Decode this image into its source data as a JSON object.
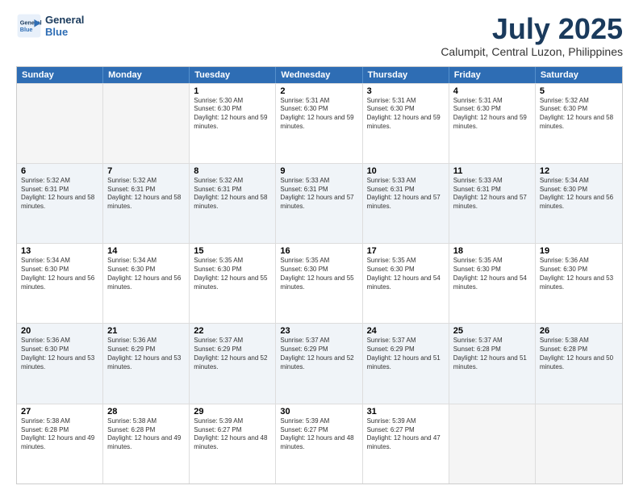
{
  "logo": {
    "line1": "General",
    "line2": "Blue"
  },
  "title": "July 2025",
  "subtitle": "Calumpit, Central Luzon, Philippines",
  "days": [
    "Sunday",
    "Monday",
    "Tuesday",
    "Wednesday",
    "Thursday",
    "Friday",
    "Saturday"
  ],
  "weeks": [
    [
      {
        "day": "",
        "empty": true
      },
      {
        "day": "",
        "empty": true
      },
      {
        "day": "1",
        "sunrise": "5:30 AM",
        "sunset": "6:30 PM",
        "daylight": "12 hours and 59 minutes."
      },
      {
        "day": "2",
        "sunrise": "5:31 AM",
        "sunset": "6:30 PM",
        "daylight": "12 hours and 59 minutes."
      },
      {
        "day": "3",
        "sunrise": "5:31 AM",
        "sunset": "6:30 PM",
        "daylight": "12 hours and 59 minutes."
      },
      {
        "day": "4",
        "sunrise": "5:31 AM",
        "sunset": "6:30 PM",
        "daylight": "12 hours and 59 minutes."
      },
      {
        "day": "5",
        "sunrise": "5:32 AM",
        "sunset": "6:30 PM",
        "daylight": "12 hours and 58 minutes."
      }
    ],
    [
      {
        "day": "6",
        "sunrise": "5:32 AM",
        "sunset": "6:31 PM",
        "daylight": "12 hours and 58 minutes."
      },
      {
        "day": "7",
        "sunrise": "5:32 AM",
        "sunset": "6:31 PM",
        "daylight": "12 hours and 58 minutes."
      },
      {
        "day": "8",
        "sunrise": "5:32 AM",
        "sunset": "6:31 PM",
        "daylight": "12 hours and 58 minutes."
      },
      {
        "day": "9",
        "sunrise": "5:33 AM",
        "sunset": "6:31 PM",
        "daylight": "12 hours and 57 minutes."
      },
      {
        "day": "10",
        "sunrise": "5:33 AM",
        "sunset": "6:31 PM",
        "daylight": "12 hours and 57 minutes."
      },
      {
        "day": "11",
        "sunrise": "5:33 AM",
        "sunset": "6:31 PM",
        "daylight": "12 hours and 57 minutes."
      },
      {
        "day": "12",
        "sunrise": "5:34 AM",
        "sunset": "6:30 PM",
        "daylight": "12 hours and 56 minutes."
      }
    ],
    [
      {
        "day": "13",
        "sunrise": "5:34 AM",
        "sunset": "6:30 PM",
        "daylight": "12 hours and 56 minutes."
      },
      {
        "day": "14",
        "sunrise": "5:34 AM",
        "sunset": "6:30 PM",
        "daylight": "12 hours and 56 minutes."
      },
      {
        "day": "15",
        "sunrise": "5:35 AM",
        "sunset": "6:30 PM",
        "daylight": "12 hours and 55 minutes."
      },
      {
        "day": "16",
        "sunrise": "5:35 AM",
        "sunset": "6:30 PM",
        "daylight": "12 hours and 55 minutes."
      },
      {
        "day": "17",
        "sunrise": "5:35 AM",
        "sunset": "6:30 PM",
        "daylight": "12 hours and 54 minutes."
      },
      {
        "day": "18",
        "sunrise": "5:35 AM",
        "sunset": "6:30 PM",
        "daylight": "12 hours and 54 minutes."
      },
      {
        "day": "19",
        "sunrise": "5:36 AM",
        "sunset": "6:30 PM",
        "daylight": "12 hours and 53 minutes."
      }
    ],
    [
      {
        "day": "20",
        "sunrise": "5:36 AM",
        "sunset": "6:30 PM",
        "daylight": "12 hours and 53 minutes."
      },
      {
        "day": "21",
        "sunrise": "5:36 AM",
        "sunset": "6:29 PM",
        "daylight": "12 hours and 53 minutes."
      },
      {
        "day": "22",
        "sunrise": "5:37 AM",
        "sunset": "6:29 PM",
        "daylight": "12 hours and 52 minutes."
      },
      {
        "day": "23",
        "sunrise": "5:37 AM",
        "sunset": "6:29 PM",
        "daylight": "12 hours and 52 minutes."
      },
      {
        "day": "24",
        "sunrise": "5:37 AM",
        "sunset": "6:29 PM",
        "daylight": "12 hours and 51 minutes."
      },
      {
        "day": "25",
        "sunrise": "5:37 AM",
        "sunset": "6:28 PM",
        "daylight": "12 hours and 51 minutes."
      },
      {
        "day": "26",
        "sunrise": "5:38 AM",
        "sunset": "6:28 PM",
        "daylight": "12 hours and 50 minutes."
      }
    ],
    [
      {
        "day": "27",
        "sunrise": "5:38 AM",
        "sunset": "6:28 PM",
        "daylight": "12 hours and 49 minutes."
      },
      {
        "day": "28",
        "sunrise": "5:38 AM",
        "sunset": "6:28 PM",
        "daylight": "12 hours and 49 minutes."
      },
      {
        "day": "29",
        "sunrise": "5:39 AM",
        "sunset": "6:27 PM",
        "daylight": "12 hours and 48 minutes."
      },
      {
        "day": "30",
        "sunrise": "5:39 AM",
        "sunset": "6:27 PM",
        "daylight": "12 hours and 48 minutes."
      },
      {
        "day": "31",
        "sunrise": "5:39 AM",
        "sunset": "6:27 PM",
        "daylight": "12 hours and 47 minutes."
      },
      {
        "day": "",
        "empty": true
      },
      {
        "day": "",
        "empty": true
      }
    ]
  ]
}
